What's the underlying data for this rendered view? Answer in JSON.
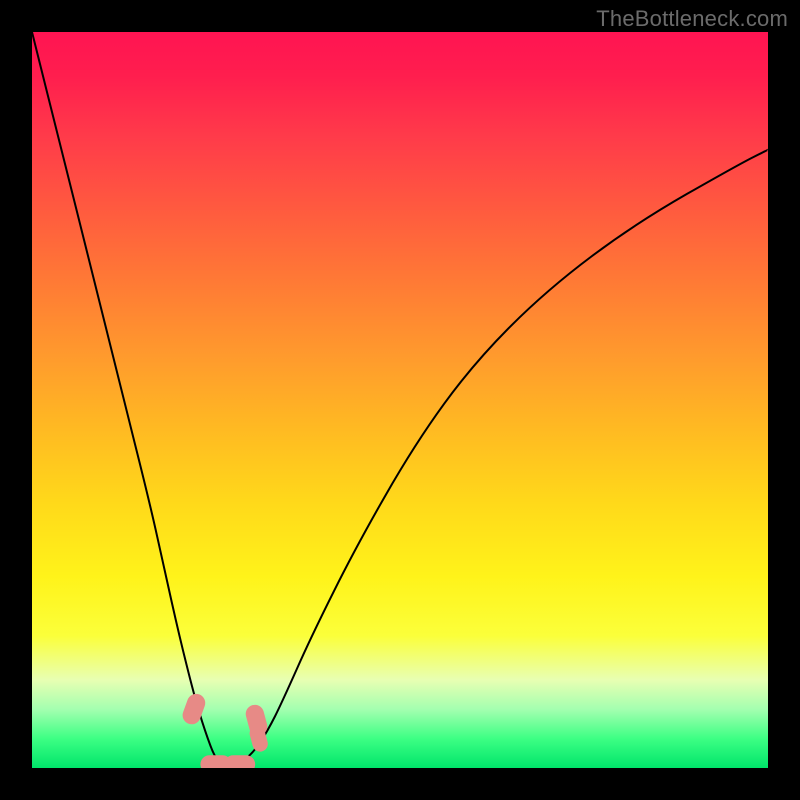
{
  "watermark": "TheBottleneck.com",
  "chart_data": {
    "type": "line",
    "title": "",
    "xlabel": "",
    "ylabel": "",
    "xlim": [
      0,
      100
    ],
    "ylim": [
      0,
      100
    ],
    "series": [
      {
        "name": "bottleneck-curve",
        "x": [
          0,
          4,
          8,
          12,
          16,
          18,
          20,
          22,
          23.5,
          25,
          26.5,
          28,
          30,
          32,
          34,
          38,
          44,
          52,
          60,
          70,
          82,
          96,
          100
        ],
        "y": [
          100,
          84,
          68,
          52,
          36,
          27,
          18,
          10,
          5,
          1,
          0,
          0.5,
          2,
          5,
          9,
          18,
          30,
          44,
          55,
          65,
          74,
          82,
          84
        ]
      }
    ],
    "markers": [
      {
        "name": "left-shoulder",
        "x": 22.0,
        "y": 8.0,
        "size": 1.3
      },
      {
        "name": "right-shoulder",
        "x": 30.5,
        "y": 6.5,
        "size": 1.3
      },
      {
        "name": "right-shoulder-2",
        "x": 30.8,
        "y": 4.0,
        "size": 1.1
      },
      {
        "name": "valley-left",
        "x": 25.0,
        "y": 0.5,
        "size": 1.3
      },
      {
        "name": "valley-right",
        "x": 28.2,
        "y": 0.5,
        "size": 1.3
      }
    ],
    "background_gradient": {
      "top": "#ff1452",
      "mid": "#ffd91a",
      "bottom": "#00e56a"
    }
  }
}
